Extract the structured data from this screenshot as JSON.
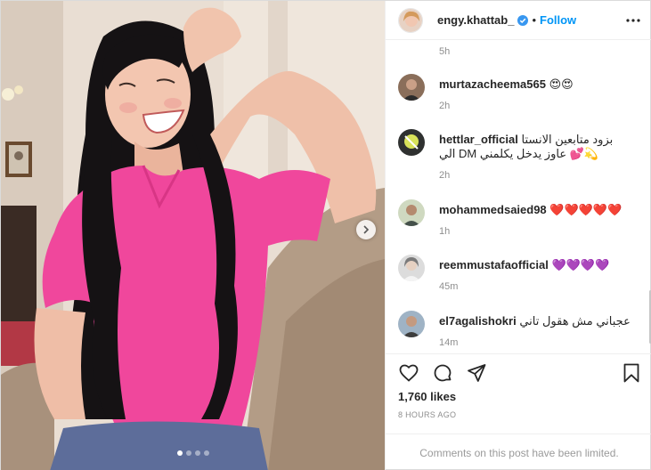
{
  "post": {
    "author": "engy.khattab_",
    "separator": "•",
    "follow_label": "Follow",
    "carousel": {
      "slide_count": 4,
      "active_slide": 1
    }
  },
  "comments": {
    "partial_time": "5h",
    "items": [
      {
        "username": "murtazacheema565",
        "text": "😍😍",
        "time": "2h"
      },
      {
        "username": "hettlar_official",
        "text": "بزود متابعين الانستا الي DM عاوز يدخل يكلمني 💕💫",
        "time": "2h"
      },
      {
        "username": "mohammedsaied98",
        "text": "❤️❤️❤️❤️❤️",
        "time": "1h"
      },
      {
        "username": "reemmustafaofficial",
        "text": "💜💜💜💜",
        "time": "45m"
      },
      {
        "username": "el7agalishokri",
        "text": "عجباني مش هقول تاني",
        "time": "14m"
      }
    ]
  },
  "stats": {
    "likes": "1,760 likes",
    "post_time": "8 HOURS AGO",
    "comments_limited": "Comments on this post have been limited."
  },
  "colors": {
    "accent": "#0095f6",
    "shirt": "#f0479c",
    "hair": "#151214",
    "skin": "#f1c2ac"
  },
  "icons": [
    "verified-badge-icon",
    "more-options-icon",
    "heart-icon",
    "comment-icon",
    "share-icon",
    "bookmark-icon",
    "chevron-right-icon"
  ]
}
